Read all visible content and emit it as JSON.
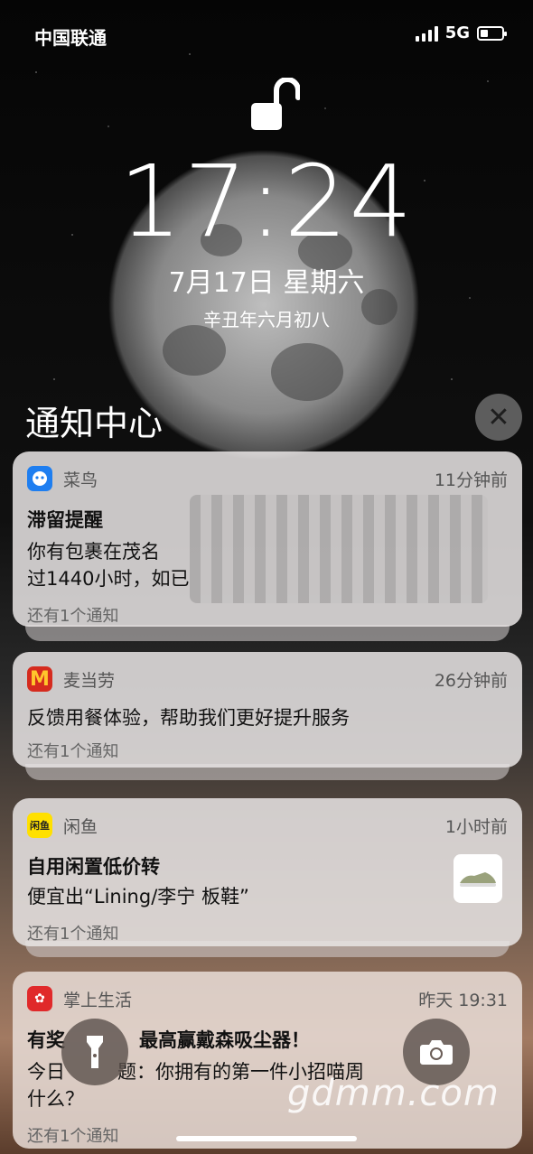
{
  "status_bar": {
    "carrier": "中国联通",
    "network": "5G",
    "battery_level": 0.3
  },
  "lock_screen": {
    "time": "17:24",
    "date": "7月17日 星期六",
    "lunar_date": "辛丑年六月初八"
  },
  "notification_center": {
    "title": "通知中心",
    "close_icon": "close-icon"
  },
  "notifications": [
    {
      "app": "菜鸟",
      "time": "11分钟前",
      "title": "滞留提醒",
      "body_line1": "你有包裹在茂名",
      "body_line2": "过1440小时，如已",
      "more": "还有1个通知",
      "icon_color": "#1e7ef0"
    },
    {
      "app": "麦当劳",
      "time": "26分钟前",
      "title": "",
      "body_line1": "反馈用餐体验，帮助我们更好提升服务",
      "more": "还有1个通知",
      "icon_color": "#d52b1e"
    },
    {
      "app": "闲鱼",
      "time": "1小时前",
      "title": "自用闲置低价转",
      "body_line1": "便宜出“Lining/李宁 板鞋”",
      "more": "还有1个通知",
      "icon_color": "#ffe000",
      "icon_label": "闲鱼"
    },
    {
      "app": "掌上生活",
      "time": "昨天 19:31",
      "title": "有奖",
      "title_tail": "最高赢戴森吸尘器！",
      "body_line1": "今日",
      "body_line1_tail": "题：你拥有的第一件小招喵周",
      "body_line2": "什么？",
      "more": "还有1个通知",
      "icon_color": "#e0292a"
    }
  ],
  "controls": {
    "flashlight": "flashlight-icon",
    "camera": "camera-icon"
  },
  "watermark": "gdmm.com"
}
